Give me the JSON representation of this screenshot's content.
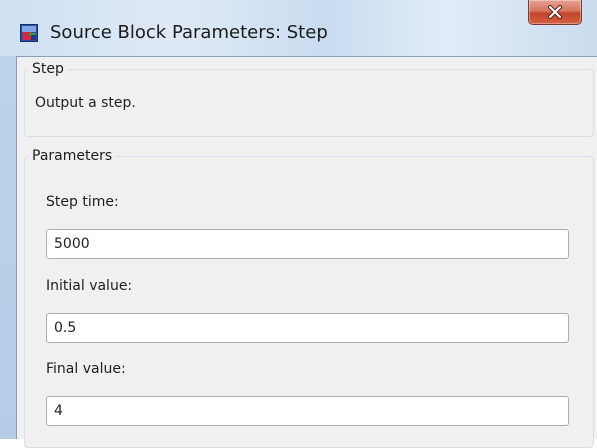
{
  "window": {
    "title": "Source Block Parameters: Step",
    "icon": "simulink-block-icon",
    "close_icon": "close-icon"
  },
  "step_group": {
    "legend": "Step",
    "description": "Output a step."
  },
  "parameters": {
    "legend": "Parameters",
    "fields": [
      {
        "label": "Step time:",
        "value": "5000"
      },
      {
        "label": "Initial value:",
        "value": "0.5"
      },
      {
        "label": "Final value:",
        "value": "4"
      }
    ]
  },
  "colors": {
    "close_button": "#c2452a",
    "titlebar": "#cfe0f2"
  }
}
